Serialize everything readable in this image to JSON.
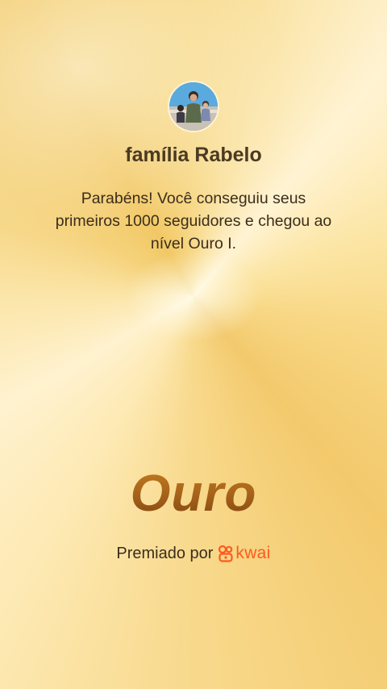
{
  "profile": {
    "name": "família Rabelo",
    "avatar": "profile-photo"
  },
  "message": "Parabéns! Você conseguiu seus primeiros 1000 seguidores e chegou ao nível Ouro I.",
  "level": {
    "title": "Ouro"
  },
  "footer": {
    "awarded_by": "Premiado por",
    "brand": "kwai",
    "brand_icon": "kwai-logo-icon",
    "brand_color": "#ff5a1f"
  },
  "colors": {
    "title_gold": "#a4611a",
    "text": "#3b2d1b",
    "background_gold": "#f7d98a"
  }
}
